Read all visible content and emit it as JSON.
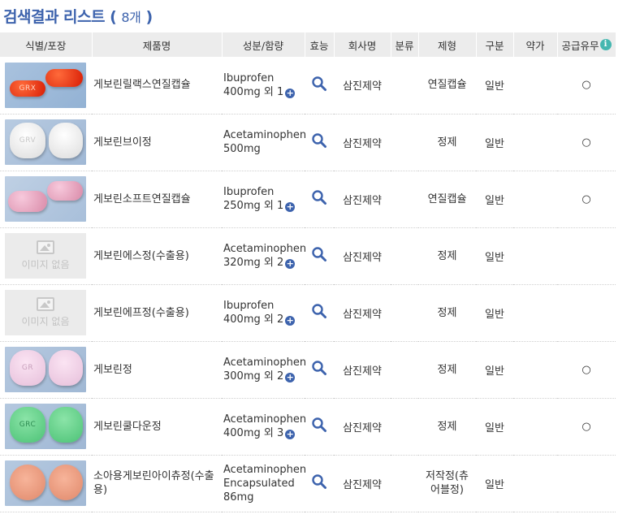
{
  "header": {
    "title": "검색결과 리스트",
    "count_open": "( ",
    "count": "8개",
    "count_close": " )"
  },
  "columns": [
    "식별/포장",
    "제품명",
    "성분/함량",
    "효능",
    "회사명",
    "분류",
    "제형",
    "구분",
    "약가",
    "공급유무"
  ],
  "noimage_label": "이미지 없음",
  "rows": [
    {
      "name": "게보린릴랙스연질캡슐",
      "ing1": "Ibuprofen",
      "ing2": "400mg 외 1",
      "company": "삼진제약",
      "category": "",
      "form": "연질캡슐",
      "type": "일반",
      "price": "",
      "supply": "○"
    },
    {
      "name": "게보린브이정",
      "ing1": "Acetaminophen",
      "ing2": "500mg",
      "company": "삼진제약",
      "category": "",
      "form": "정제",
      "type": "일반",
      "price": "",
      "supply": "○"
    },
    {
      "name": "게보린소프트연질캡슐",
      "ing1": "Ibuprofen",
      "ing2": "250mg 외 1",
      "company": "삼진제약",
      "category": "",
      "form": "연질캡슐",
      "type": "일반",
      "price": "",
      "supply": "○"
    },
    {
      "name": "게보린에스정(수출용)",
      "ing1": "Acetaminophen",
      "ing2": "320mg 외 2",
      "company": "삼진제약",
      "category": "",
      "form": "정제",
      "type": "일반",
      "price": "",
      "supply": ""
    },
    {
      "name": "게보린에프정(수출용)",
      "ing1": "Ibuprofen",
      "ing2": "400mg 외 2",
      "company": "삼진제약",
      "category": "",
      "form": "정제",
      "type": "일반",
      "price": "",
      "supply": ""
    },
    {
      "name": "게보린정",
      "ing1": "Acetaminophen",
      "ing2": "300mg 외 2",
      "company": "삼진제약",
      "category": "",
      "form": "정제",
      "type": "일반",
      "price": "",
      "supply": "○"
    },
    {
      "name": "게보린쿨다운정",
      "ing1": "Acetaminophen",
      "ing2": "400mg 외 3",
      "company": "삼진제약",
      "category": "",
      "form": "정제",
      "type": "일반",
      "price": "",
      "supply": "○"
    },
    {
      "name": "소아용게보린아이츄정(수출용)",
      "ing1": "Acetaminophen",
      "ing2": "Encapsulated",
      "ing3": "86mg",
      "company": "삼진제약",
      "category": "",
      "form": "저작정(츄어블정)",
      "type": "일반",
      "price": "",
      "supply": ""
    }
  ],
  "pill_marks": {
    "r0": "GRX",
    "r1": "GRV",
    "r5": "GR",
    "r6": "GRC"
  },
  "colors": {
    "accent": "#3d63ad",
    "info": "#45b7b0",
    "header_bg": "#ececec"
  },
  "icons": {
    "efficacy": "search-icon",
    "more": "plus-icon",
    "supply_info": "info-icon"
  }
}
